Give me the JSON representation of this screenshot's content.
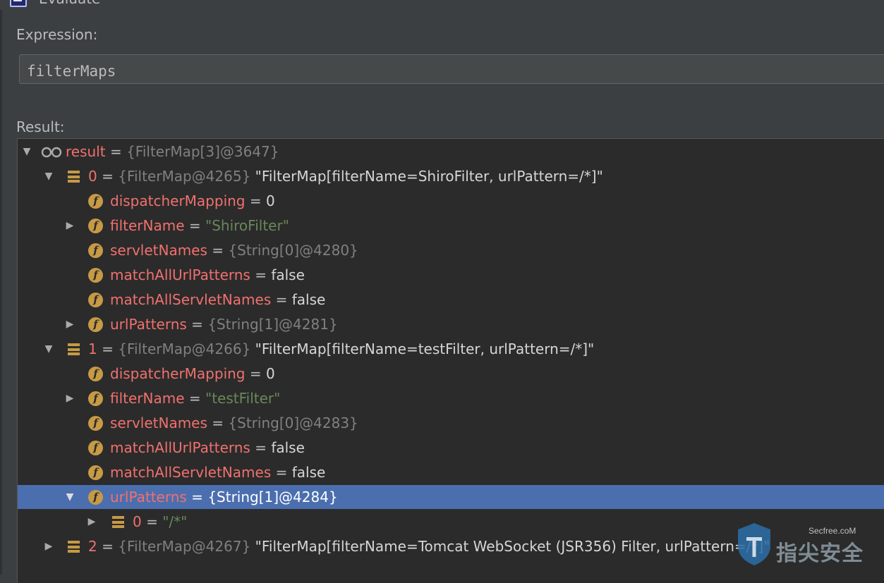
{
  "window": {
    "title": "Evaluate"
  },
  "expression": {
    "label": "Expression:",
    "value": "filterMaps"
  },
  "result": {
    "label": "Result:"
  },
  "tree": [
    {
      "name": "result",
      "eq": " = ",
      "ref": "{FilterMap[3]@3647}",
      "str": "",
      "plain": ""
    },
    {
      "name": "0",
      "eq": " = ",
      "ref": "{FilterMap@4265}",
      "str": "",
      "plain": " \"FilterMap[filterName=ShiroFilter, urlPattern=/*]\""
    },
    {
      "name": "dispatcherMapping",
      "eq": " = ",
      "ref": "",
      "str": "",
      "plain": "0"
    },
    {
      "name": "filterName",
      "eq": " = ",
      "ref": "",
      "str": "\"ShiroFilter\"",
      "plain": ""
    },
    {
      "name": "servletNames",
      "eq": " = ",
      "ref": "{String[0]@4280}",
      "str": "",
      "plain": ""
    },
    {
      "name": "matchAllUrlPatterns",
      "eq": " = ",
      "ref": "",
      "str": "",
      "plain": "false"
    },
    {
      "name": "matchAllServletNames",
      "eq": " = ",
      "ref": "",
      "str": "",
      "plain": "false"
    },
    {
      "name": "urlPatterns",
      "eq": " = ",
      "ref": "{String[1]@4281}",
      "str": "",
      "plain": ""
    },
    {
      "name": "1",
      "eq": " = ",
      "ref": "{FilterMap@4266}",
      "str": "",
      "plain": " \"FilterMap[filterName=testFilter, urlPattern=/*]\""
    },
    {
      "name": "dispatcherMapping",
      "eq": " = ",
      "ref": "",
      "str": "",
      "plain": "0"
    },
    {
      "name": "filterName",
      "eq": " = ",
      "ref": "",
      "str": "\"testFilter\"",
      "plain": ""
    },
    {
      "name": "servletNames",
      "eq": " = ",
      "ref": "{String[0]@4283}",
      "str": "",
      "plain": ""
    },
    {
      "name": "matchAllUrlPatterns",
      "eq": " = ",
      "ref": "",
      "str": "",
      "plain": "false"
    },
    {
      "name": "matchAllServletNames",
      "eq": " = ",
      "ref": "",
      "str": "",
      "plain": "false"
    },
    {
      "name": "urlPatterns",
      "eq": " = ",
      "ref": "{String[1]@4284}",
      "str": "",
      "plain": ""
    },
    {
      "name": "0",
      "eq": " = ",
      "ref": "",
      "str": "\"/*\"",
      "plain": ""
    },
    {
      "name": "2",
      "eq": " = ",
      "ref": "{FilterMap@4267}",
      "str": "",
      "plain": " \"FilterMap[filterName=Tomcat WebSocket (JSR356) Filter, urlPattern=/*]\""
    }
  ],
  "watermark": {
    "domain": "Secfree.coM",
    "name": "指尖安全"
  },
  "colors": {
    "selection": "#4b6eaf",
    "field_name": "#f0716e",
    "string_value": "#6a8759",
    "reference": "#808080",
    "icon": "#c79a45"
  },
  "icons": {
    "field": "field-f-icon",
    "array": "array-icon",
    "watch": "watch-glasses-icon"
  }
}
